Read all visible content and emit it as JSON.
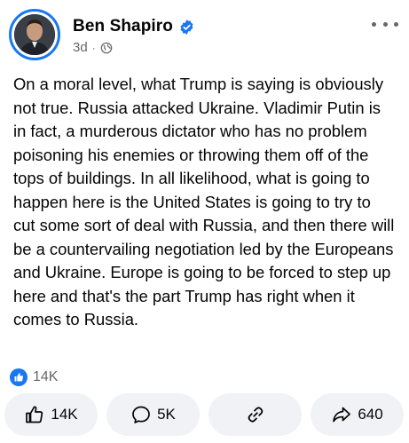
{
  "post": {
    "author": "Ben Shapiro",
    "time": "3d",
    "separator": "·",
    "text": "On a moral level, what Trump is saying is obviously not true. Russia attacked Ukraine. Vladimir Putin is in fact, a murderous dictator who has no problem poisoning his enemies or throwing them off of the tops of buildings. In all likelihood, what is going to happen here is the United States is going to try to cut some sort of deal with Russia, and then there will be a countervailing negotiation led by the Europeans and Ukraine. Europe is going to be forced to step up here and that's the part Trump has right when it comes to Russia.",
    "audience_icon": "globe-icon",
    "verified_icon": "verified-badge-icon"
  },
  "reactions": {
    "count": "14K",
    "icon": "like-badge-icon"
  },
  "actions": {
    "like_count": "14K",
    "comment_count": "5K",
    "share_count": "640"
  },
  "colors": {
    "accent": "#1877f2",
    "button_bg": "#f0f2f5",
    "secondary_text": "#65676b"
  }
}
